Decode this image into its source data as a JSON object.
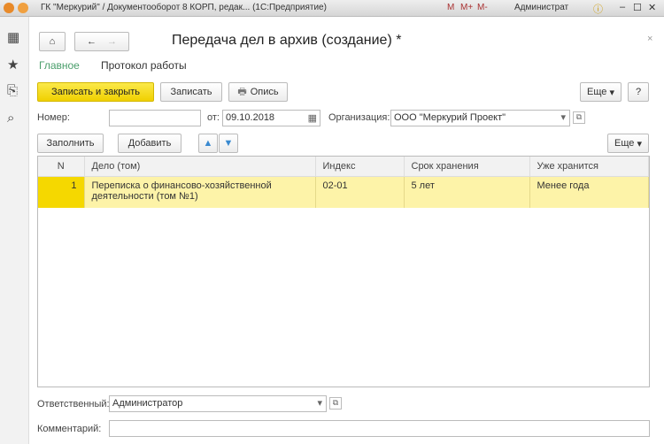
{
  "window": {
    "title": "ГК \"Меркурий\" / Документооборот 8 КОРП, редак... (1С:Предприятие)",
    "user": "Администрат",
    "m": "M",
    "mplus": "M+",
    "mminus": "M-"
  },
  "form": {
    "title": "Передача дел в архив (создание) *",
    "tabs": [
      "Главное",
      "Протокол работы"
    ]
  },
  "toolbar": {
    "save_close": "Записать и закрыть",
    "save": "Записать",
    "inventory": "Опись",
    "more": "Еще",
    "help": "?"
  },
  "fields": {
    "number_label": "Номер:",
    "number_value": "",
    "date_label": "от:",
    "date_value": "09.10.2018",
    "org_label": "Организация:",
    "org_value": "ООО \"Меркурий Проект\"",
    "resp_label": "Ответственный:",
    "resp_value": "Администратор",
    "comment_label": "Комментарий:",
    "comment_value": ""
  },
  "table_toolbar": {
    "fill": "Заполнить",
    "add": "Добавить",
    "more": "Еще"
  },
  "table": {
    "columns": [
      "N",
      "Дело (том)",
      "Индекс",
      "Срок хранения",
      "Уже хранится"
    ],
    "rows": [
      [
        "1",
        "Переписка о финансово-хозяйственной деятельности (том №1)",
        "02-01",
        "5 лет",
        "Менее года"
      ]
    ]
  },
  "colors": {
    "accent": "#f5d800",
    "tab_active": "#4a9e6b",
    "row_selected": "#fdf3a8"
  }
}
